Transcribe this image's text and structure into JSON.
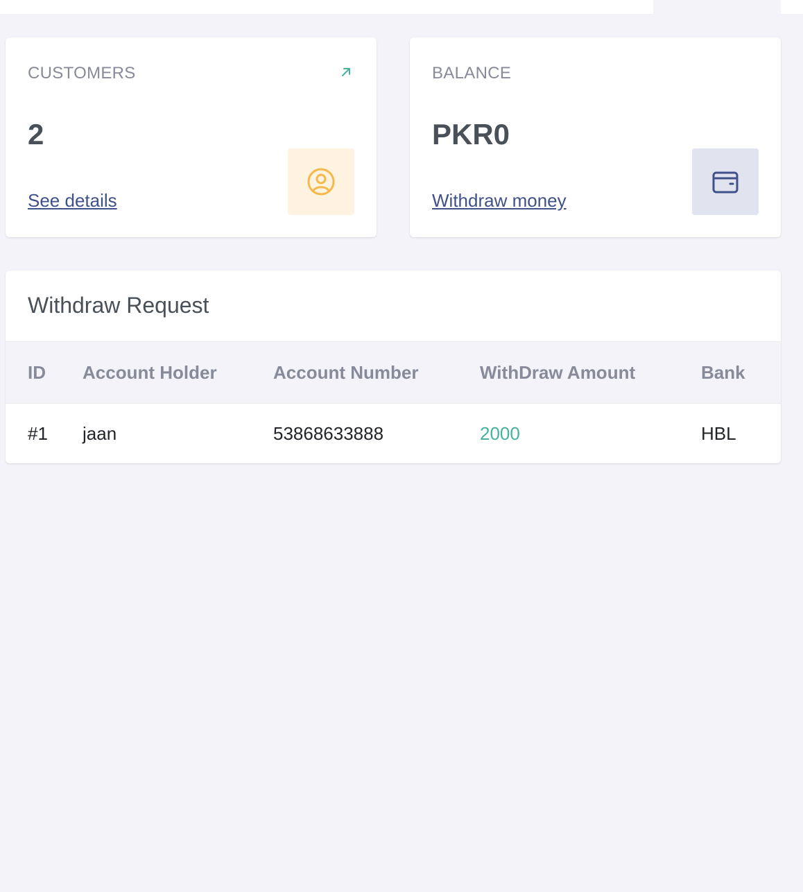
{
  "stats": {
    "customers": {
      "label": "CUSTOMERS",
      "value": "2",
      "link": "See details",
      "trend_icon": "arrow-up-right-icon",
      "icon": "user-circle-icon",
      "accent": "#f7b84b"
    },
    "balance": {
      "label": "BALANCE",
      "value": "PKR0",
      "link": "Withdraw money",
      "icon": "wallet-icon",
      "accent": "#405189"
    }
  },
  "withdraw_requests": {
    "title": "Withdraw Request",
    "columns": [
      "ID",
      "Account Holder",
      "Account Number",
      "WithDraw Amount",
      "Bank"
    ],
    "rows": [
      {
        "id": "#1",
        "account_holder": "jaan",
        "account_number": "53868633888",
        "amount": "2000",
        "bank": "HBL"
      }
    ]
  },
  "colors": {
    "page_bg": "#f3f3f9",
    "link": "#405189",
    "success": "#45b39d",
    "muted": "#878a99"
  }
}
